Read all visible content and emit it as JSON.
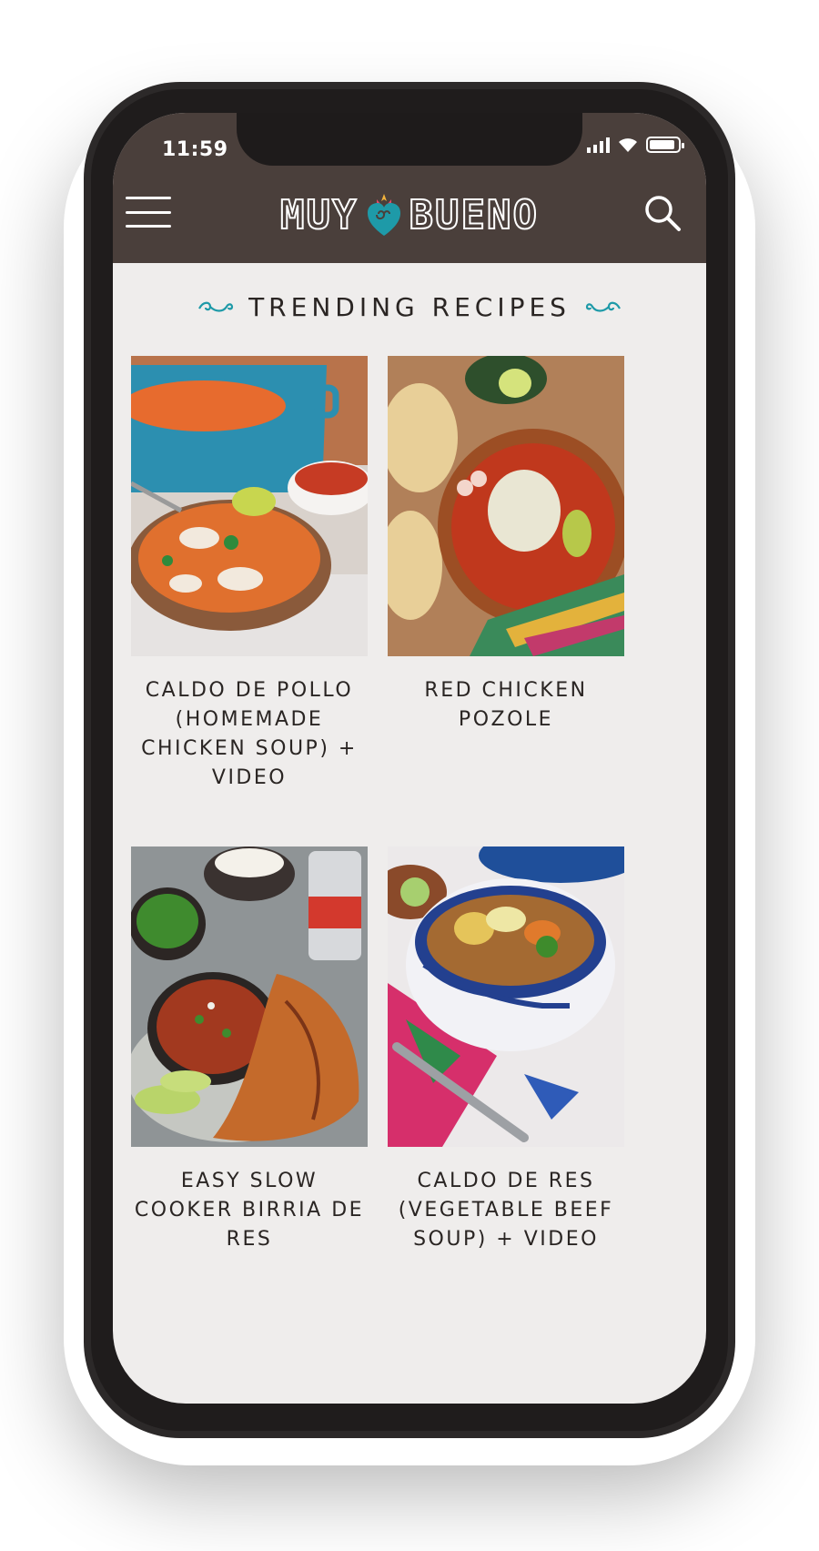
{
  "status_bar": {
    "time": "11:59",
    "battery_level": 0.9
  },
  "header": {
    "logo_left": "MUY",
    "logo_right": "BUENO",
    "menu_icon": "hamburger-menu-icon",
    "search_icon": "search-icon",
    "colors": {
      "background": "#4a3f3b",
      "accent": "#1e9aa8"
    }
  },
  "section": {
    "title": "TRENDING RECIPES"
  },
  "recipes": [
    {
      "title": "CALDO DE POLLO (HOMEMADE CHICKEN SOUP) + VIDEO"
    },
    {
      "title": "RED CHICKEN POZOLE"
    },
    {
      "title": "EASY SLOW COOKER BIRRIA DE RES"
    },
    {
      "title": "CALDO DE RES (VEGETABLE BEEF SOUP) + VIDEO"
    }
  ]
}
